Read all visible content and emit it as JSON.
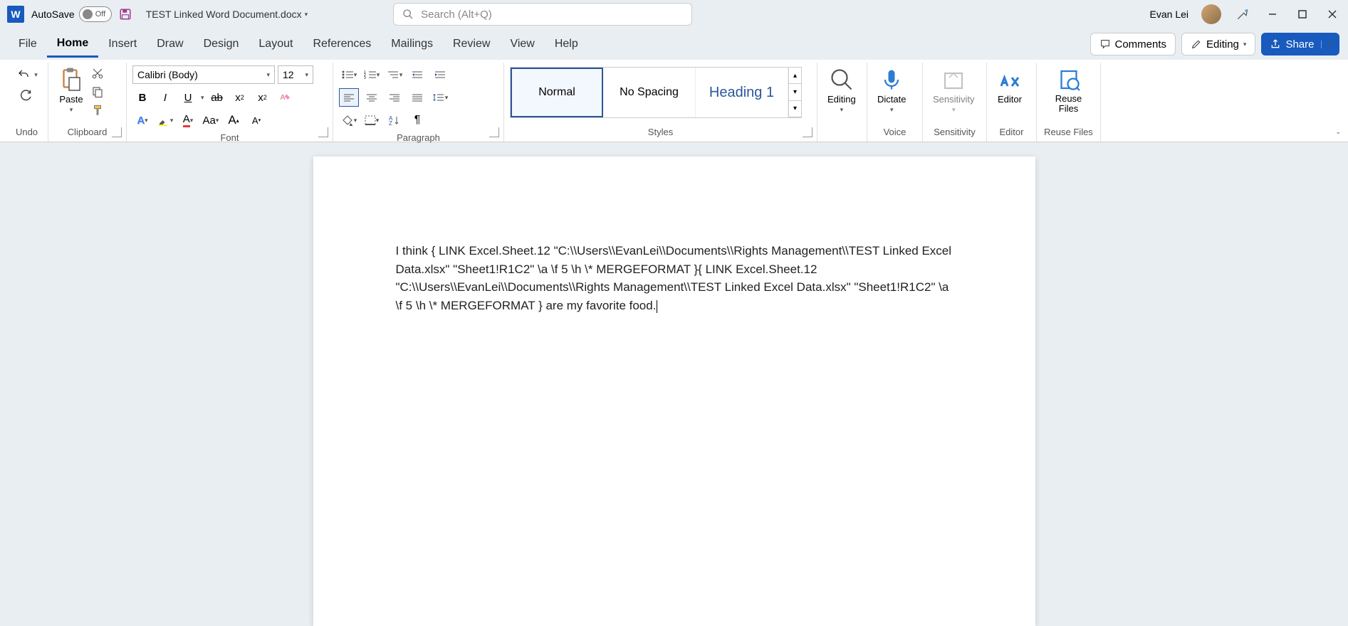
{
  "titlebar": {
    "autosave_label": "AutoSave",
    "autosave_state": "Off",
    "doc_title": "TEST Linked Word Document.docx",
    "search_placeholder": "Search (Alt+Q)",
    "username": "Evan Lei"
  },
  "tabs": {
    "items": [
      "File",
      "Home",
      "Insert",
      "Draw",
      "Design",
      "Layout",
      "References",
      "Mailings",
      "Review",
      "View",
      "Help"
    ],
    "active": "Home",
    "comments": "Comments",
    "editing": "Editing",
    "share": "Share"
  },
  "ribbon": {
    "undo": {
      "label": "Undo"
    },
    "clipboard": {
      "paste": "Paste",
      "label": "Clipboard"
    },
    "font": {
      "name": "Calibri (Body)",
      "size": "12",
      "label": "Font"
    },
    "paragraph": {
      "label": "Paragraph"
    },
    "styles": {
      "items": [
        "Normal",
        "No Spacing",
        "Heading 1"
      ],
      "label": "Styles"
    },
    "editing": {
      "label": "Editing"
    },
    "voice": {
      "dictate": "Dictate",
      "label": "Voice"
    },
    "sensitivity": {
      "button": "Sensitivity",
      "label": "Sensitivity"
    },
    "editor": {
      "button": "Editor",
      "label": "Editor"
    },
    "reuse": {
      "button": "Reuse Files",
      "label": "Reuse Files"
    }
  },
  "document": {
    "text": "I think { LINK Excel.Sheet.12 \"C:\\\\Users\\\\EvanLei\\\\Documents\\\\Rights Management\\\\TEST Linked Excel Data.xlsx\" \"Sheet1!R1C2\" \\a \\f 5 \\h  \\* MERGEFORMAT }{ LINK Excel.Sheet.12 \"C:\\\\Users\\\\EvanLei\\\\Documents\\\\Rights Management\\\\TEST Linked Excel Data.xlsx\" \"Sheet1!R1C2\" \\a \\f 5 \\h  \\* MERGEFORMAT } are my favorite food."
  }
}
